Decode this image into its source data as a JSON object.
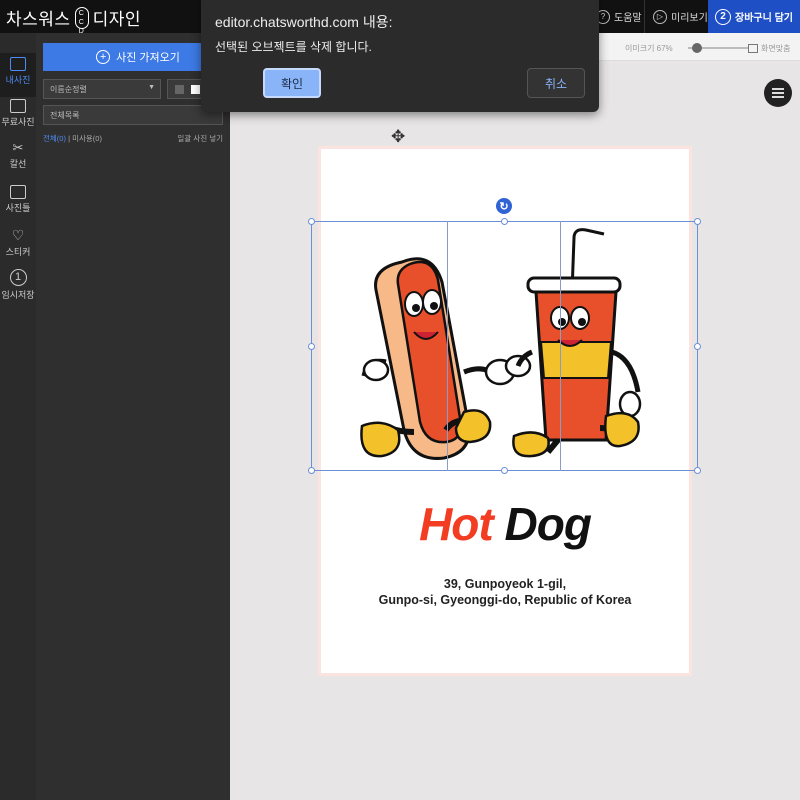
{
  "header": {
    "logo": {
      "left": "차스워스",
      "coin": "C C D",
      "right": "디자인"
    },
    "help_label": "도움말",
    "preview_label": "미리보기",
    "cart_step": "2",
    "cart_label": "장바구니 담기"
  },
  "rail": {
    "items": [
      {
        "label": "내사진",
        "icon": "camera-icon",
        "active": true
      },
      {
        "label": "무료사진",
        "icon": "free-photo-icon"
      },
      {
        "label": "칼선",
        "icon": "scissors-icon"
      },
      {
        "label": "사진틀",
        "icon": "frame-icon"
      },
      {
        "label": "스티커",
        "icon": "heart-icon"
      },
      {
        "label": "임시저장",
        "icon": "save-number-icon",
        "badge": "1"
      }
    ]
  },
  "panel": {
    "upload_label": "사진 가져오기",
    "sort_value": "이름순정렬",
    "folder_value": "전체목록",
    "filter_all": "전체(0)",
    "filter_unused": "미사용(0)",
    "auto_fill": "일괄 사진 넣기"
  },
  "toolbar": {
    "zoom_label": "이미크기 67%",
    "fit_label": "화면맞춤"
  },
  "design": {
    "headline_word1": "Hot",
    "headline_word2": "Dog",
    "address_line1": "39, Gunpoyeok 1-gil,",
    "address_line2": "Gunpo-si, Gyeonggi-do, Republic of Korea"
  },
  "dialog": {
    "title": "editor.chatsworthd.com 내용:",
    "message": "선택된 오브젝트를 삭제 합니다.",
    "ok_label": "확인",
    "cancel_label": "취소"
  },
  "colors": {
    "accent_blue": "#3d7ae6",
    "cart_blue": "#1f4fc4",
    "headline_red": "#f23d23"
  }
}
